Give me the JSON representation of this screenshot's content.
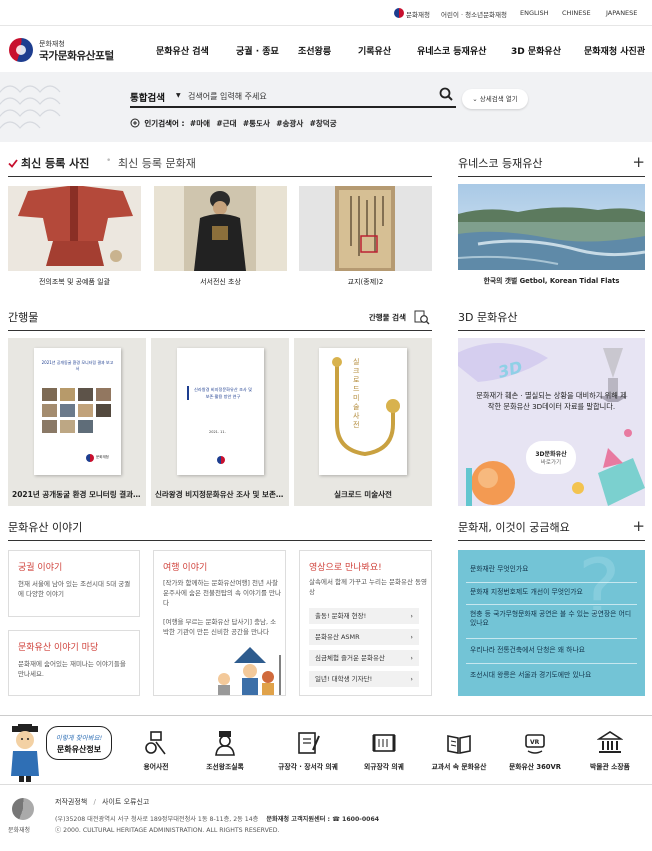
{
  "util": {
    "agency": "문화재청",
    "kids": "어린이 · 청소년문화재청",
    "langs": [
      "ENGLISH",
      "CHINESE",
      "JAPANESE"
    ]
  },
  "brand": {
    "sub": "문화재청",
    "main": "국가문화유산포털"
  },
  "gnb": [
    "문화유산 검색",
    "궁궐 · 종묘",
    "조선왕릉",
    "기록유산",
    "유네스코 등재유산",
    "3D 문화유산",
    "문화재청 사진관"
  ],
  "search": {
    "scope": "통합검색",
    "placeholder": "검색어를 입력해 주세요",
    "detail": "상세검색 열기",
    "popular_label": "인기검색어 :",
    "popular": [
      "#마애",
      "#근대",
      "#통도사",
      "#송광사",
      "#창덕궁"
    ]
  },
  "recent": {
    "tab_active": "최신 등록 사진",
    "tab_inactive": "최신 등록 문화재",
    "cards": [
      "전의조복 및 공예품 일괄",
      "서서전신 초상",
      "교지(종제)2"
    ]
  },
  "unesco": {
    "title": "유네스코 등재유산",
    "caption": "한국의 갯벌 Getbol, Korean Tidal Flats"
  },
  "pubs": {
    "title": "간행물",
    "search": "간행물 검색",
    "books": [
      {
        "caption": "2021년 공개동굴 환경 모니터링 결과 보고서",
        "cover_title": "2021년 공개동굴 환경 모니터링 결과 보고서",
        "cover_sub": "문화재청"
      },
      {
        "caption": "신라왕경 비지정문화유산 조사 및 보존 · 활용 방안 연구",
        "cover_title": "신라왕경 비지정문화유산 조사 및 보존·활용 방안 연구",
        "cover_sub": "2021. 11."
      },
      {
        "caption": "실크로드 미술사전",
        "cover_title": "실크로드 미술사전"
      }
    ]
  },
  "three_d": {
    "title": "3D 문화유산",
    "desc": "문화재가 훼손 · 멸실되는 상황을 대비하기 위해 제작한 문화유산 3D데이터 자료를 말합니다.",
    "badge": "3D문화유산",
    "badge_sub": "바로가기",
    "deco": "3D"
  },
  "stories": {
    "title": "문화유산 이야기",
    "box1": {
      "title": "궁궐 이야기",
      "text": "현재 서울에 남아 있는 조선시대 5대 궁궐에 다양한 이야기"
    },
    "box2": {
      "title": "문화유산 이야기 마당",
      "text": "문화재에 숨어있는 재미나는 이야기들을 만나세요."
    },
    "box3": {
      "title": "여행 이야기",
      "text1": "[작가와 함께하는 문화유산여행] 천년 사찰 운주사에 숨은 천불천탑의 속 이야기를 만나다",
      "text2": "[여행을 부르는 문화유산 답사기] 충남, 소박한 기관이 만든 신비한 공간을 만나다"
    },
    "box4": {
      "title": "영상으로 만나봐요!",
      "text": "살속에서 함께 가꾸고 누리는 문화유산 동영상",
      "videos": [
        "출동! 문화재 현장!",
        "문화유산 ASMR",
        "심금체험 즐거운 문화유산",
        "일년! 대학생 기자단!"
      ]
    }
  },
  "faq": {
    "title": "문화재, 이것이 궁금해요",
    "items": [
      "문화재란 무엇인가요",
      "문화재 지정번호제도 개선이 무엇인가요",
      "현충 등 국가무형문화재 공연은 볼 수 있는 공연장은 어디있나요",
      "우리나라 전통건축에서 단청은 왜 하나요",
      "조선시대 왕릉은 서울과 경기도에만 있나요"
    ]
  },
  "quick": {
    "mascot_bubble1": "이렇게 찾아봐요!",
    "mascot_bubble2": "문화유산정보",
    "items": [
      "용어사전",
      "조선왕조실록",
      "규장각 · 장서각 의궤",
      "외규장각 의궤",
      "교과서 속 문화유산",
      "문화유산 360VR",
      "박물관 소장품"
    ]
  },
  "footer": {
    "links": [
      "저작권정책",
      "사이트 오류신고"
    ],
    "sep": "/",
    "logo_txt": "문화재청",
    "address": "(우)35208 대전광역시 서구 청사로 189정부대전청사 1동 8-11층, 2동 14층",
    "phone": "문화재청 고객지원센터 : ☎ 1600-0064",
    "copyright": "ⓒ 2000. CULTURAL HERITAGE ADMINISTRATION. ALL RIGHTS RESERVED."
  },
  "colors": {
    "accent_red": "#c8102e",
    "brand_blue": "#1d3d8f",
    "faq_bg": "#73c4d6",
    "story_title": "#d0433c"
  }
}
